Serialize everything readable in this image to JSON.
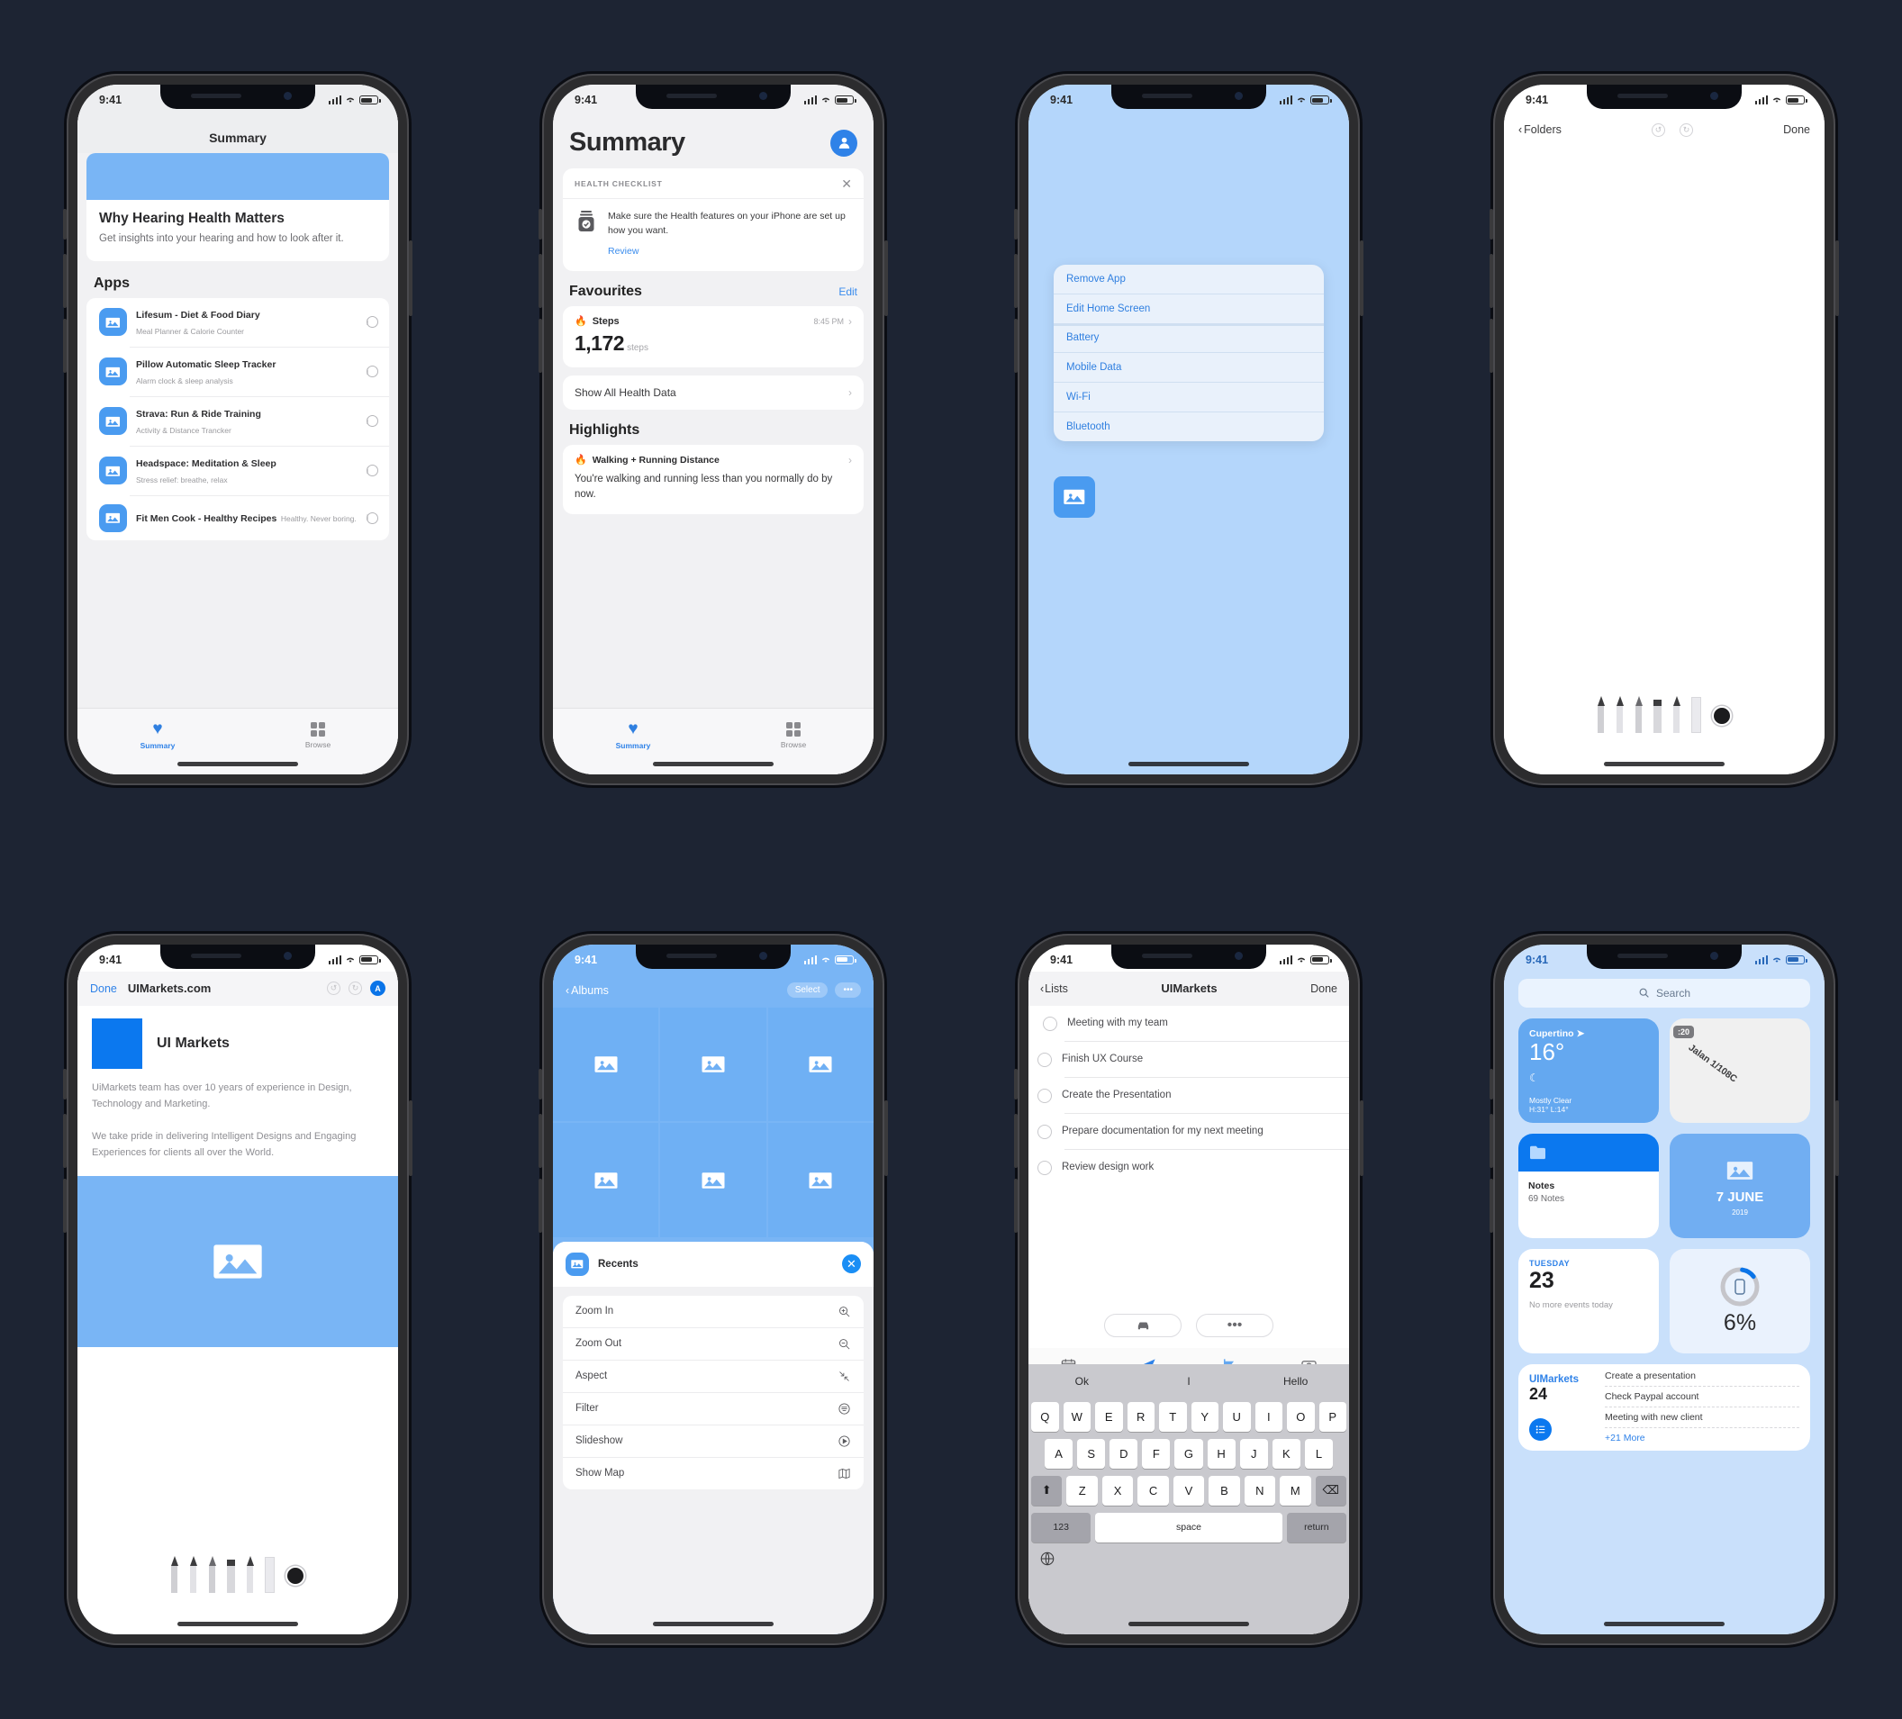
{
  "status_bar": {
    "time": "9:41"
  },
  "phone1": {
    "nav_title": "Summary",
    "hero": {
      "title": "Why Hearing Health Matters",
      "subtitle": "Get insights into your hearing and how to look after it."
    },
    "section_title": "Apps",
    "apps": [
      {
        "name": "Lifesum - Diet & Food Diary",
        "sub": "Meal Planner & Calorie Counter"
      },
      {
        "name": "Pillow Automatic Sleep Tracker",
        "sub": "Alarm clock & sleep analysis"
      },
      {
        "name": "Strava: Run & Ride Training",
        "sub": "Activity & Distance Trancker"
      },
      {
        "name": "Headspace: Meditation & Sleep",
        "sub": "Stress relief: breathe, relax"
      },
      {
        "name": "Fit Men Cook - Healthy Recipes",
        "sub": "Healthy. Never boring."
      }
    ],
    "tabs": [
      {
        "label": "Summary"
      },
      {
        "label": "Browse"
      }
    ]
  },
  "phone2": {
    "title": "Summary",
    "checklist": {
      "header": "HEALTH CHECKLIST",
      "body": "Make sure the Health features on your iPhone are set up how you want.",
      "action": "Review"
    },
    "favourites": {
      "heading": "Favourites",
      "edit": "Edit",
      "metric": "Steps",
      "time": "8:45 PM",
      "value": "1,172",
      "unit": "steps"
    },
    "show_all": "Show All Health Data",
    "highlights": {
      "heading": "Highlights",
      "metric": "Walking + Running Distance",
      "body": "You're walking and running less than you normally do by now."
    },
    "tabs": [
      {
        "label": "Summary"
      },
      {
        "label": "Browse"
      }
    ]
  },
  "phone3": {
    "menu_items": [
      "Remove App",
      "Edit Home Screen",
      "Battery",
      "Mobile Data",
      "Wi-Fi",
      "Bluetooth"
    ]
  },
  "phone4": {
    "back": "Folders",
    "done": "Done"
  },
  "phone5": {
    "done": "Done",
    "url": "UIMarkets.com",
    "reader_badge": "A",
    "brand": "UI Markets",
    "paragraphs": [
      "UiMarkets team has over 10 years of experience in Design, Technology and Marketing.",
      "We take pride in delivering Intelligent Designs and Engaging Experiences for clients all over the World."
    ]
  },
  "phone6": {
    "back": "Albums",
    "select": "Select",
    "more": "•••",
    "sheet_title": "Recents",
    "menu": [
      {
        "label": "Zoom In",
        "icon": "zoom-in-icon"
      },
      {
        "label": "Zoom Out",
        "icon": "zoom-out-icon"
      },
      {
        "label": "Aspect",
        "icon": "aspect-icon"
      },
      {
        "label": "Filter",
        "icon": "filter-icon"
      },
      {
        "label": "Slideshow",
        "icon": "slideshow-icon"
      },
      {
        "label": "Show Map",
        "icon": "map-icon"
      }
    ]
  },
  "phone7": {
    "back": "Lists",
    "title": "UIMarkets",
    "done": "Done",
    "reminders": [
      "Meeting with my team",
      "Finish UX Course",
      "Create the Presentation",
      "Prepare documentation for my next meeting",
      "Review design work"
    ],
    "keyboard": {
      "predictions": [
        "Ok",
        "I",
        "Hello"
      ],
      "row1": [
        "Q",
        "W",
        "E",
        "R",
        "T",
        "Y",
        "U",
        "I",
        "O",
        "P"
      ],
      "row2": [
        "A",
        "S",
        "D",
        "F",
        "G",
        "H",
        "J",
        "K",
        "L"
      ],
      "row3": [
        "Z",
        "X",
        "C",
        "V",
        "B",
        "N",
        "M"
      ],
      "numeric": "123",
      "space": "space",
      "return": "return"
    }
  },
  "phone8": {
    "search_placeholder": "Search",
    "weather": {
      "city": "Cupertino",
      "temp": "16°",
      "condition": "Mostly Clear",
      "highlow": "H:31° L:14°"
    },
    "map": {
      "badge": ":20",
      "street": "Jalan 1/108C"
    },
    "notes": {
      "title": "Notes",
      "count": "69 Notes"
    },
    "photos": {
      "date": "7 JUNE",
      "year": "2019"
    },
    "calendar": {
      "dow": "TUESDAY",
      "day": "23",
      "events": "No more events today"
    },
    "battery": {
      "percent": "6%"
    },
    "reminders": {
      "title": "UIMarkets",
      "count": "24",
      "items": [
        "Create a presentation",
        "Check Paypal account",
        "Meeting with new client"
      ],
      "more": "+21 More"
    }
  },
  "colors": {
    "accent": "#2f82e8",
    "light_blue": "#79b5f5",
    "bg": "#1d2433"
  }
}
